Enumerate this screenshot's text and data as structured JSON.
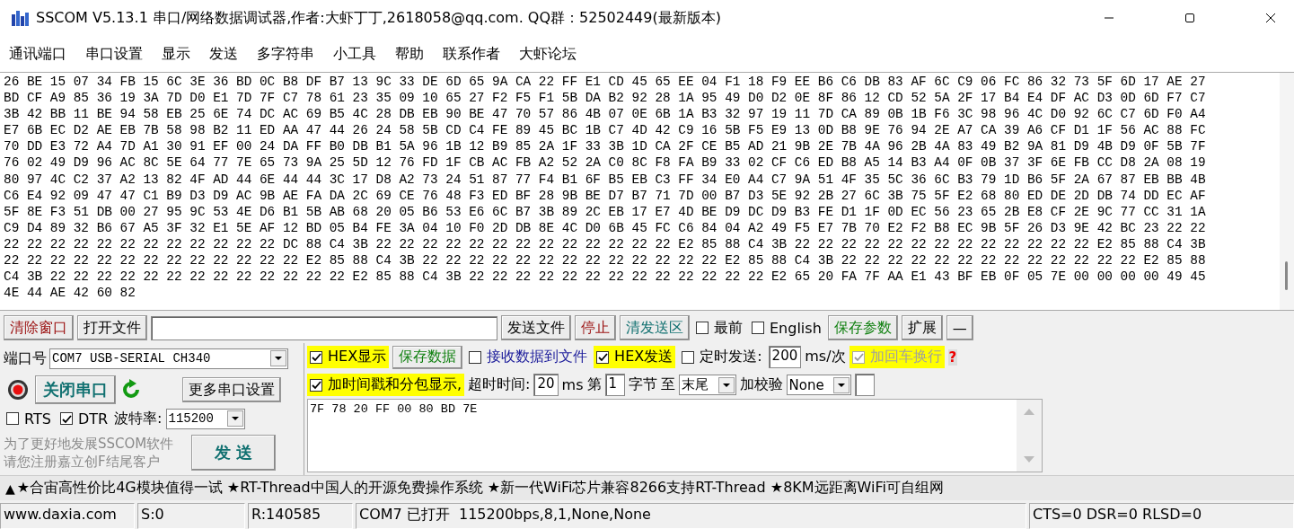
{
  "window": {
    "title": "SSCOM V5.13.1 串口/网络数据调试器,作者:大虾丁丁,2618058@qq.com. QQ群：52502449(最新版本)"
  },
  "menu": [
    "通讯端口",
    "串口设置",
    "显示",
    "发送",
    "多字符串",
    "小工具",
    "帮助",
    "联系作者",
    "大虾论坛"
  ],
  "receive": {
    "lines": [
      "26 BE 15 07 34 FB 15 6C 3E 36 BD 0C B8 DF B7 13 9C 33 DE 6D 65 9A CA 22 FF E1 CD 45 65 EE 04 F1 18 F9 EE B6 C6 DB 83 AF 6C C9 06 FC 86 32 73 5F 6D 17 AE 27",
      "BD CF A9 85 36 19 3A 7D D0 E1 7D 7F C7 78 61 23 35 09 10 65 27 F2 F5 F1 5B DA B2 92 28 1A 95 49 D0 D2 0E 8F 86 12 CD 52 5A 2F 17 B4 E4 DF AC D3 0D 6D F7 C7",
      "3B 42 BB 11 BE 94 58 EB 25 6E 74 DC AC 69 B5 4C 28 DB EB 90 BE 47 70 57 86 4B 07 0E 6B 1A B3 32 97 19 11 7D CA 89 0B 1B F6 3C 98 96 4C D0 92 6C C7 6D F0 A4",
      "E7 6B EC D2 AE EB 7B 58 98 B2 11 ED AA 47 44 26 24 58 5B CD C4 FE 89 45 BC 1B C7 4D 42 C9 16 5B F5 E9 13 0D B8 9E 76 94 2E A7 CA 39 A6 CF D1 1F 56 AC 88 FC",
      "70 DD E3 72 A4 7D A1 30 91 EF 00 24 DA FF B0 DB B1 5A 96 1B 12 B9 85 2A 1F 33 3B 1D CA 2F CE B5 AD 21 9B 2E 7B 4A 96 2B 4A 83 49 B2 9A 81 D9 4B D9 0F 5B 7F",
      "76 02 49 D9 96 AC 8C 5E 64 77 7E 65 73 9A 25 5D 12 76 FD 1F CB AC FB A2 52 2A C0 8C F8 FA B9 33 02 CF C6 ED B8 A5 14 B3 A4 0F 0B 37 3F 6E FB CC D8 2A 08 19",
      "80 97 4C C2 37 A2 13 82 4F AD 44 6E 44 44 3C 17 D8 A2 73 24 51 87 77 F4 B1 6F B5 EB C3 FF 34 E0 A4 C7 9A 51 4F 35 5C 36 6C B3 79 1D B6 5F 2A 67 87 EB BB 4B",
      "C6 E4 92 09 47 47 C1 B9 D3 D9 AC 9B AE FA DA 2C 69 CE 76 48 F3 ED BF 28 9B BE D7 B7 71 7D 00 B7 D3 5E 92 2B 27 6C 3B 75 5F E2 68 80 ED DE 2D DB 74 DD EC AF",
      "5F 8E F3 51 DB 00 27 95 9C 53 4E D6 B1 5B AB 68 20 05 B6 53 E6 6C B7 3B 89 2C EB 17 E7 4D BE D9 DC D9 B3 FE D1 1F 0D EC 56 23 65 2B E8 CF 2E 9C 77 CC 31 1A",
      "C9 D4 89 32 B6 67 A5 3F 32 E1 5E AF 12 BD 05 B4 FE 3A 04 10 F0 2D DB 8E 4C D0 6B 45 FC C6 84 04 A2 49 F5 E7 7B 70 E2 F2 B8 EC 9B 5F 26 D3 9E 42 BC 23 22 22",
      "22 22 22 22 22 22 22 22 22 22 22 22 DC 88 C4 3B 22 22 22 22 22 22 22 22 22 22 22 22 22 E2 85 88 C4 3B 22 22 22 22 22 22 22 22 22 22 22 22 22 E2 85 88 C4 3B",
      "22 22 22 22 22 22 22 22 22 22 22 22 22 E2 85 88 C4 3B 22 22 22 22 22 22 22 22 22 22 22 22 22 E2 85 88 C4 3B 22 22 22 22 22 22 22 22 22 22 22 22 22 E2 85 88",
      "C4 3B 22 22 22 22 22 22 22 22 22 22 22 22 22 E2 85 88 C4 3B 22 22 22 22 22 22 22 22 22 22 22 22 22 E2 65 20 FA 7F AA E1 43 BF EB 0F 05 7E 00 00 00 00 49 45",
      "4E 44 AE 42 60 82"
    ]
  },
  "toolbar": [
    {
      "kind": "button",
      "label": "清除窗口",
      "color": "#9b1010"
    },
    {
      "kind": "button",
      "label": "打开文件"
    },
    {
      "kind": "field"
    },
    {
      "kind": "button",
      "label": "发送文件"
    },
    {
      "kind": "button",
      "label": "停止",
      "color": "#9b1010"
    },
    {
      "kind": "button",
      "label": "清发送区",
      "color": "#107070"
    },
    {
      "kind": "check",
      "label": "最前",
      "checked": false
    },
    {
      "kind": "check",
      "label": "English",
      "checked": false
    },
    {
      "kind": "button",
      "label": "保存参数",
      "color": "#108010"
    },
    {
      "kind": "button",
      "label": "扩展"
    },
    {
      "kind": "button",
      "label": "—"
    }
  ],
  "port": {
    "label": "端口号",
    "device": "COM7 USB-SERIAL CH340",
    "open": true,
    "toggle_button": "关闭串口",
    "more_button": "更多串口设置",
    "rts": {
      "label": "RTS",
      "checked": false
    },
    "dtr": {
      "label": "DTR",
      "checked": true
    },
    "baud_label": "波特率:",
    "baud": "115200",
    "notice": [
      "为了更好地发展SSCOM软件",
      "请您注册嘉立创F结尾客户"
    ],
    "send_button": "发 送"
  },
  "options": {
    "row_1": [
      {
        "kind": "check",
        "label": "HEX显示",
        "checked": true,
        "highlight": true
      },
      {
        "kind": "button",
        "label": "保存数据"
      },
      {
        "kind": "check",
        "label": "接收数据到文件",
        "checked": false,
        "color": "#1a1a9a"
      },
      {
        "kind": "check",
        "label": "HEX发送",
        "checked": true,
        "highlight": true
      },
      {
        "kind": "check",
        "label": "定时发送:",
        "checked": false
      },
      {
        "kind": "field",
        "value": "200"
      },
      {
        "kind": "text",
        "label": "ms/次"
      },
      {
        "kind": "check",
        "label": "加回车换行",
        "checked": true,
        "highlight": true,
        "disabled": true
      },
      {
        "kind": "help",
        "label": "?"
      }
    ],
    "row_2": [
      {
        "kind": "check",
        "label": "加时间戳和分包显示,",
        "checked": true,
        "highlight": true
      },
      {
        "kind": "text",
        "label": "超时时间:"
      },
      {
        "kind": "field",
        "value": "20"
      },
      {
        "kind": "text",
        "label": "ms"
      },
      {
        "kind": "text",
        "label": "第"
      },
      {
        "kind": "field",
        "value": "1"
      },
      {
        "kind": "text",
        "label": "字节"
      },
      {
        "kind": "text",
        "label": "至"
      },
      {
        "kind": "select",
        "value": "末尾"
      },
      {
        "kind": "text",
        "label": "加校验"
      },
      {
        "kind": "select",
        "value": "None"
      },
      {
        "kind": "field"
      }
    ]
  },
  "send": {
    "text": "7F 78 20 FF 00 80 BD 7E"
  },
  "ticker": {
    "arrow": "▲",
    "text": "★合宙高性价比4G模块值得一试 ★RT-Thread中国人的开源免费操作系统 ★新一代WiFi芯片兼容8266支持RT-Thread ★8KM远距离WiFi可自组网"
  },
  "status_bar": [
    "www.daxia.com",
    "S:0",
    "R:140585",
    "COM7 已打开  115200bps,8,1,None,None",
    "CTS=0 DSR=0 RLSD=0"
  ]
}
